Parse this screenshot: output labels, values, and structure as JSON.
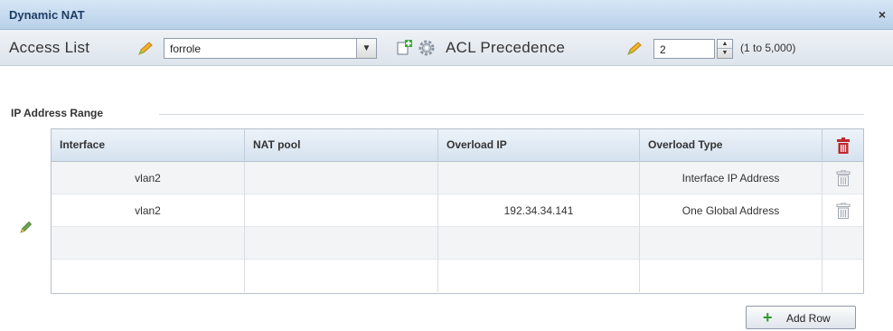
{
  "dialog": {
    "title": "Dynamic NAT",
    "close_glyph": "×"
  },
  "toolbar": {
    "access_list_label": "Access List",
    "access_list_value": "forrole",
    "acl_precedence_label": "ACL Precedence",
    "acl_precedence_value": "2",
    "acl_precedence_range": "(1 to 5,000)",
    "icons": [
      "pencil-icon",
      "dropdown-arrow-icon",
      "new-document-icon",
      "gear-icon",
      "pencil-icon",
      "spinner-icon"
    ]
  },
  "section": {
    "label": "IP Address Range"
  },
  "table": {
    "columns": [
      "Interface",
      "NAT pool",
      "Overload IP",
      "Overload Type"
    ],
    "rows": [
      [
        "vlan2",
        "",
        "",
        "Interface IP Address"
      ],
      [
        "vlan2",
        "",
        "192.34.34.141",
        "One Global Address"
      ],
      [
        "",
        "",
        "",
        ""
      ],
      [
        "",
        "",
        "",
        ""
      ]
    ],
    "header_icon": "trash-icon",
    "header_icon_color": "#c0282d"
  },
  "buttons": {
    "add_row_label": "Add Row",
    "add_row_icon": "plus-icon",
    "add_row_icon_color": "#2e9a2e"
  }
}
